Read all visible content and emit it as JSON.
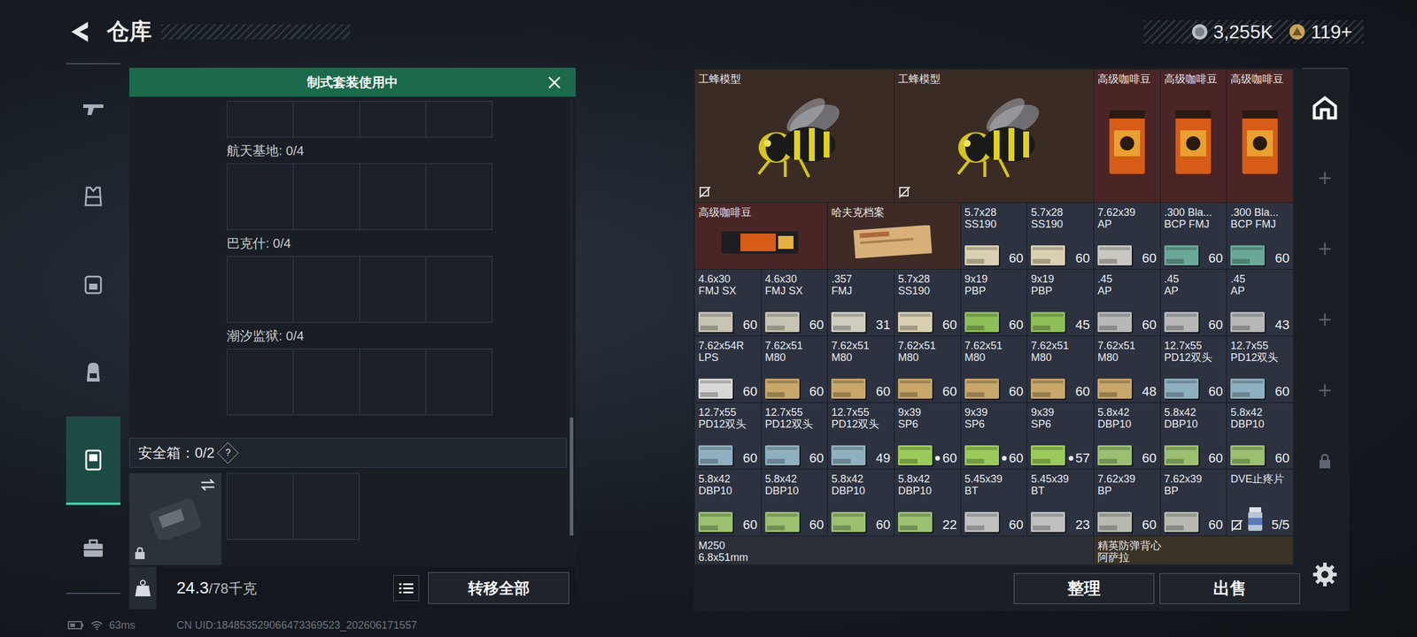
{
  "header": {
    "title": "仓库",
    "currencies": [
      {
        "value": "3,255K",
        "kind": "silver"
      },
      {
        "value": "119+",
        "kind": "gold"
      }
    ]
  },
  "sidebar": {
    "items": [
      {
        "selected": false
      },
      {
        "selected": false
      },
      {
        "selected": false
      },
      {
        "selected": false
      },
      {
        "selected": true
      },
      {
        "selected": false
      }
    ]
  },
  "loadout": {
    "banner": "制式套装使用中",
    "sections": [
      {
        "label": "航天基地: 0/4"
      },
      {
        "label": "巴克什: 0/4"
      },
      {
        "label": "潮汐监狱: 0/4"
      }
    ],
    "safe_box": {
      "label": "安全箱：0/2",
      "help": "?",
      "locked": true
    },
    "weight": "24.3",
    "capacity": "/78千克",
    "transfer_button": "转移全部"
  },
  "stash": {
    "items": [
      {
        "kind": "bee",
        "name": "工蜂模型",
        "color": "#3b2b25",
        "locked": true
      },
      {
        "kind": "bee",
        "name": "工蜂模型",
        "color": "#3b2b25",
        "locked": true
      },
      {
        "kind": "coffee_tall",
        "name": "高级咖啡豆",
        "color": "#4a2526"
      },
      {
        "kind": "coffee_tall",
        "name": "高级咖啡豆",
        "color": "#4a2526"
      },
      {
        "kind": "coffee_tall",
        "name": "高级咖啡豆",
        "color": "#4a2526"
      },
      {
        "kind": "coffee_wide",
        "name": "高级咖啡豆",
        "color": "#4a2526"
      },
      {
        "kind": "folder",
        "name": "哈夫克档案",
        "color": "#3f2a26"
      },
      {
        "kind": "ammo",
        "name": "5.7x28",
        "sub": "SS190",
        "count": "60",
        "color": "#2c3240",
        "tint": "#d8d0b0"
      },
      {
        "kind": "ammo",
        "name": "5.7x28",
        "sub": "SS190",
        "count": "60",
        "color": "#2c3240",
        "tint": "#d8d0b0"
      },
      {
        "kind": "ammo",
        "name": "7.62x39",
        "sub": "AP",
        "count": "60",
        "color": "#2c3240",
        "tint": "#c8c8c0"
      },
      {
        "kind": "ammo",
        "name": ".300 Bla...",
        "sub": "BCP FMJ",
        "count": "60",
        "color": "#2c3240",
        "tint": "#6aa89a"
      },
      {
        "kind": "ammo",
        "name": ".300 Bla...",
        "sub": "BCP FMJ",
        "count": "60",
        "color": "#2c3240",
        "tint": "#6aa89a"
      },
      {
        "kind": "ammo",
        "name": "4.6x30",
        "sub": "FMJ SX",
        "count": "60",
        "color": "#2c3240",
        "tint": "#c8c4b4"
      },
      {
        "kind": "ammo",
        "name": "4.6x30",
        "sub": "FMJ SX",
        "count": "60",
        "color": "#2c3240",
        "tint": "#c8c4b4"
      },
      {
        "kind": "ammo",
        "name": ".357",
        "sub": "FMJ",
        "count": "31",
        "color": "#2c3240",
        "tint": "#d0ccc0"
      },
      {
        "kind": "ammo",
        "name": "5.7x28",
        "sub": "SS190",
        "count": "60",
        "color": "#2c3240",
        "tint": "#d8d0b0"
      },
      {
        "kind": "ammo",
        "name": "9x19",
        "sub": "PBP",
        "count": "60",
        "color": "#2c3240",
        "tint": "#8fbf5a"
      },
      {
        "kind": "ammo",
        "name": "9x19",
        "sub": "PBP",
        "count": "45",
        "color": "#2c3240",
        "tint": "#8fbf5a"
      },
      {
        "kind": "ammo",
        "name": ".45",
        "sub": "AP",
        "count": "60",
        "color": "#2c3240",
        "tint": "#b8b8b8"
      },
      {
        "kind": "ammo",
        "name": ".45",
        "sub": "AP",
        "count": "60",
        "color": "#2c3240",
        "tint": "#b8b8b8"
      },
      {
        "kind": "ammo",
        "name": ".45",
        "sub": "AP",
        "count": "43",
        "color": "#2c3240",
        "tint": "#b8b8b8"
      },
      {
        "kind": "ammo",
        "name": "7.62x54R",
        "sub": "LPS",
        "count": "60",
        "color": "#2c3240",
        "tint": "#d8d8d8"
      },
      {
        "kind": "ammo",
        "name": "7.62x51",
        "sub": "M80",
        "count": "60",
        "color": "#2c3240",
        "tint": "#c9a76a"
      },
      {
        "kind": "ammo",
        "name": "7.62x51",
        "sub": "M80",
        "count": "60",
        "color": "#2c3240",
        "tint": "#c9a76a"
      },
      {
        "kind": "ammo",
        "name": "7.62x51",
        "sub": "M80",
        "count": "60",
        "color": "#2c3240",
        "tint": "#c9a76a"
      },
      {
        "kind": "ammo",
        "name": "7.62x51",
        "sub": "M80",
        "count": "60",
        "color": "#2c3240",
        "tint": "#c9a76a"
      },
      {
        "kind": "ammo",
        "name": "7.62x51",
        "sub": "M80",
        "count": "60",
        "color": "#2c3240",
        "tint": "#c9a76a"
      },
      {
        "kind": "ammo",
        "name": "7.62x51",
        "sub": "M80",
        "count": "48",
        "color": "#2c3240",
        "tint": "#c9a76a"
      },
      {
        "kind": "ammo",
        "name": "12.7x55",
        "sub": "PD12双头",
        "count": "60",
        "color": "#2c3240",
        "tint": "#8fb0c0"
      },
      {
        "kind": "ammo",
        "name": "12.7x55",
        "sub": "PD12双头",
        "count": "60",
        "color": "#2c3240",
        "tint": "#8fb0c0"
      },
      {
        "kind": "ammo",
        "name": "12.7x55",
        "sub": "PD12双头",
        "count": "60",
        "color": "#2c3240",
        "tint": "#8fb0c0"
      },
      {
        "kind": "ammo",
        "name": "12.7x55",
        "sub": "PD12双头",
        "count": "60",
        "color": "#2c3240",
        "tint": "#8fb0c0"
      },
      {
        "kind": "ammo",
        "name": "12.7x55",
        "sub": "PD12双头",
        "count": "49",
        "color": "#2c3240",
        "tint": "#8fb0c0"
      },
      {
        "kind": "ammo",
        "name": "9x39",
        "sub": "SP6",
        "count": "60",
        "color": "#2c3240",
        "tint": "#9acb5a",
        "marked": true
      },
      {
        "kind": "ammo",
        "name": "9x39",
        "sub": "SP6",
        "count": "60",
        "color": "#2c3240",
        "tint": "#9acb5a",
        "marked": true
      },
      {
        "kind": "ammo",
        "name": "9x39",
        "sub": "SP6",
        "count": "57",
        "color": "#2c3240",
        "tint": "#9acb5a",
        "marked": true
      },
      {
        "kind": "ammo",
        "name": "5.8x42",
        "sub": "DBP10",
        "count": "60",
        "color": "#2c3240",
        "tint": "#9ac070"
      },
      {
        "kind": "ammo",
        "name": "5.8x42",
        "sub": "DBP10",
        "count": "60",
        "color": "#2c3240",
        "tint": "#9ac070"
      },
      {
        "kind": "ammo",
        "name": "5.8x42",
        "sub": "DBP10",
        "count": "60",
        "color": "#2c3240",
        "tint": "#9ac070"
      },
      {
        "kind": "ammo",
        "name": "5.8x42",
        "sub": "DBP10",
        "count": "60",
        "color": "#2c3240",
        "tint": "#9ac070"
      },
      {
        "kind": "ammo",
        "name": "5.8x42",
        "sub": "DBP10",
        "count": "60",
        "color": "#2c3240",
        "tint": "#9ac070"
      },
      {
        "kind": "ammo",
        "name": "5.8x42",
        "sub": "DBP10",
        "count": "60",
        "color": "#2c3240",
        "tint": "#9ac070"
      },
      {
        "kind": "ammo",
        "name": "5.8x42",
        "sub": "DBP10",
        "count": "22",
        "color": "#2c3240",
        "tint": "#9ac070"
      },
      {
        "kind": "ammo",
        "name": "5.45x39",
        "sub": "BT",
        "count": "60",
        "color": "#2c3240",
        "tint": "#c0c0c0"
      },
      {
        "kind": "ammo",
        "name": "5.45x39",
        "sub": "BT",
        "count": "23",
        "color": "#2c3240",
        "tint": "#c0c0c0"
      },
      {
        "kind": "ammo",
        "name": "7.62x39",
        "sub": "BP",
        "count": "60",
        "color": "#2c3240",
        "tint": "#b8bab0"
      },
      {
        "kind": "ammo",
        "name": "7.62x39",
        "sub": "BP",
        "count": "60",
        "color": "#2c3240",
        "tint": "#b8bab0"
      },
      {
        "kind": "pills",
        "name": "DVE止疼片",
        "count": "5/5",
        "color": "#2c3240",
        "locked": true
      },
      {
        "kind": "gun",
        "name": "M250",
        "sub": "6.8x51mm",
        "color": "#2a2f38"
      },
      {
        "kind": "vest",
        "name": "精英防弹背心",
        "sub": "阿萨拉",
        "color": "#3a3226"
      }
    ]
  },
  "buttons": [
    "整理",
    "出售"
  ],
  "rail": {
    "items": [
      {
        "kind": "home",
        "selected": true
      },
      {
        "kind": "add",
        "selected": false
      },
      {
        "kind": "add",
        "selected": false
      },
      {
        "kind": "add",
        "selected": false
      },
      {
        "kind": "add",
        "selected": false
      },
      {
        "kind": "lock",
        "selected": false
      }
    ]
  },
  "status_bar": {
    "ping": "63ms",
    "uid": "CN UID:184853529066473369523_202606171557"
  }
}
